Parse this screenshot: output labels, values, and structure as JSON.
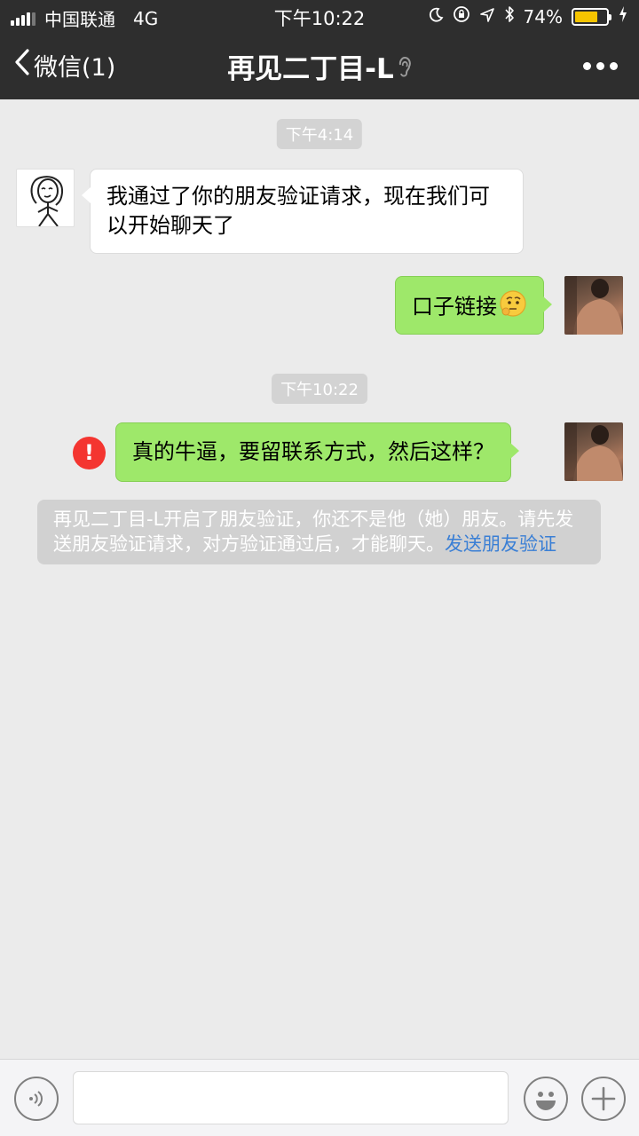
{
  "status_bar": {
    "carrier": "中国联通",
    "network": "4G",
    "time": "下午10:22",
    "battery_percent": "74%",
    "battery_level": 0.74,
    "icons": [
      "signal-icon",
      "moon-icon",
      "rotation-lock-icon",
      "location-icon",
      "bluetooth-icon",
      "battery-icon",
      "charging-icon"
    ]
  },
  "nav": {
    "back_label": "微信(1)",
    "title": "再见二丁目-L",
    "icons": [
      "chevron-left-icon",
      "ear-icon",
      "more-icon"
    ]
  },
  "chat": {
    "time_1": "下午4:14",
    "friend_msg": "我通过了你的朋友验证请求，现在我们可以开始聊天了",
    "my_msg_1": "口子链接",
    "time_2": "下午10:22",
    "my_msg_2": "真的牛逼，要留联系方式，然后这样？",
    "error_mark": "!",
    "notice_text": "再见二丁目-L开启了朋友验证，你还不是他（她）朋友。请先发送朋友验证请求，对方验证通过后，才能聊天。",
    "notice_link": "发送朋友验证"
  },
  "input_bar": {
    "message_value": "",
    "icons": [
      "voice-icon",
      "emoji-icon",
      "plus-icon"
    ]
  },
  "colors": {
    "bar_bg": "#2e2e2e",
    "chat_bg": "#ebebeb",
    "green_bubble": "#9ee86a",
    "error_red": "#f43530",
    "link_blue": "#3a7fd5",
    "battery_fill": "#f5c400"
  }
}
